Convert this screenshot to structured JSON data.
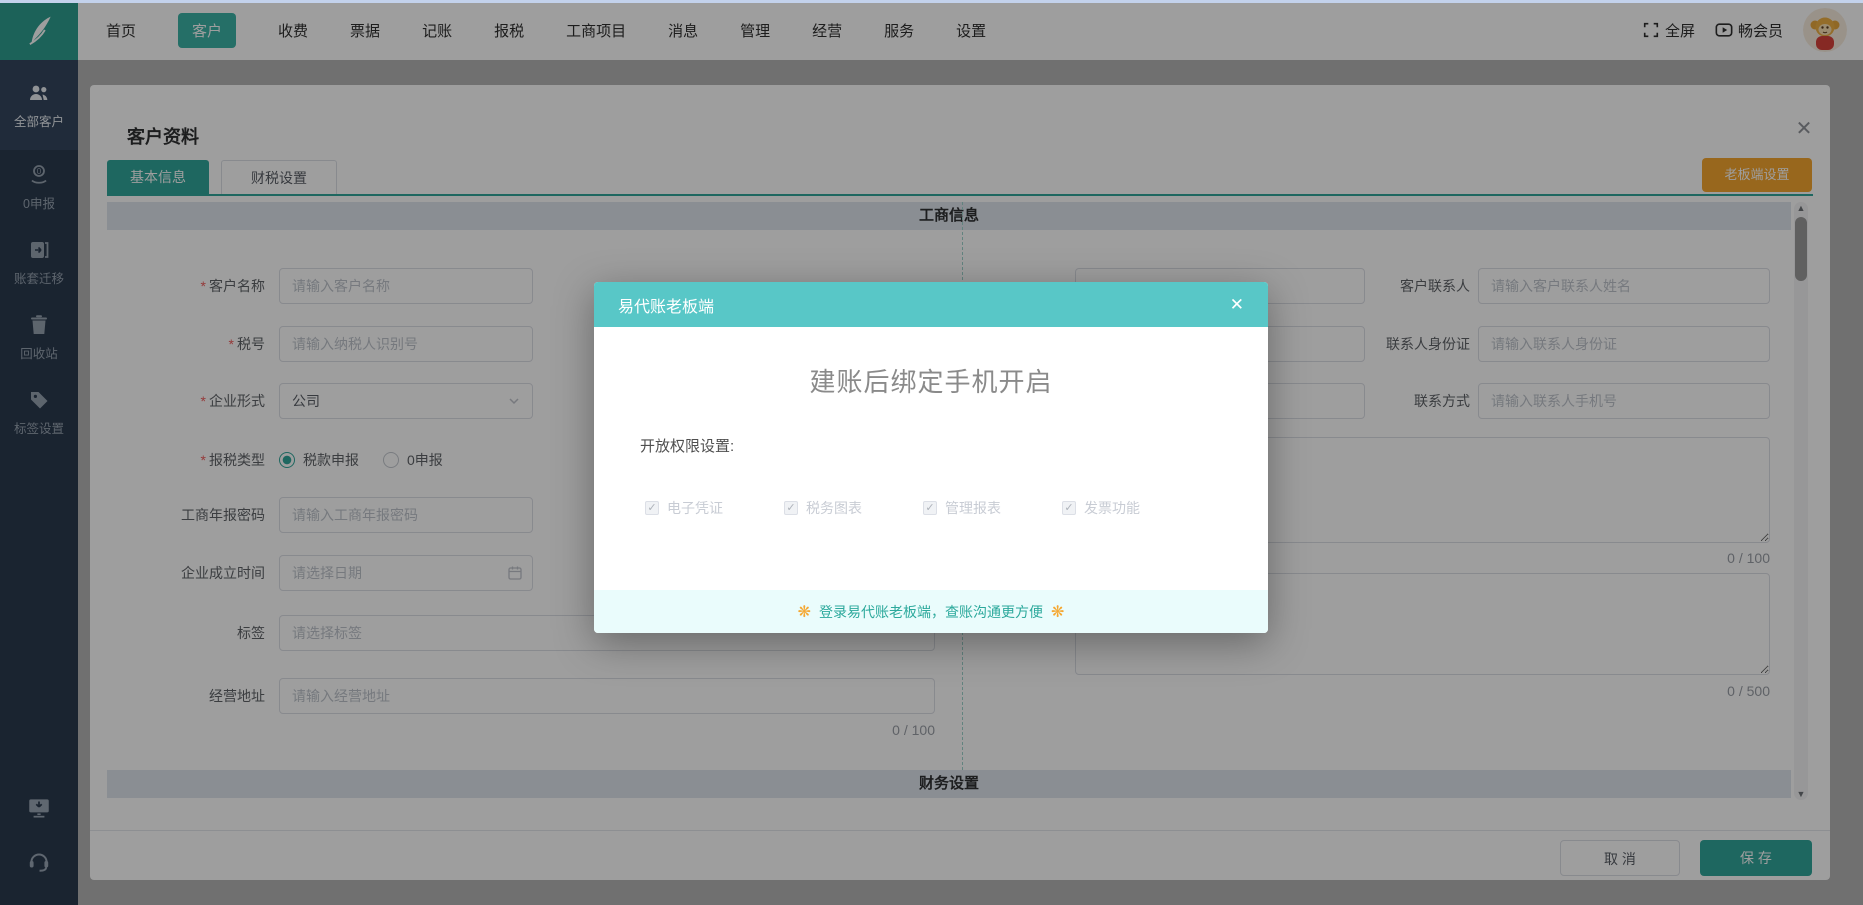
{
  "topnav": {
    "items": [
      "首页",
      "客户",
      "收费",
      "票据",
      "记账",
      "报税",
      "工商项目",
      "消息",
      "管理",
      "经营",
      "服务",
      "设置"
    ],
    "active_item": "客户",
    "fullscreen_label": "全屏",
    "member_label": "畅会员"
  },
  "sidebar": {
    "items": [
      {
        "label": "全部客户",
        "icon": "users-icon",
        "active": true
      },
      {
        "label": "0申报",
        "icon": "zero-declare-icon",
        "active": false
      },
      {
        "label": "账套迁移",
        "icon": "ledger-migrate-icon",
        "active": false
      },
      {
        "label": "回收站",
        "icon": "trash-icon",
        "active": false
      },
      {
        "label": "标签设置",
        "icon": "tag-icon",
        "active": false
      }
    ]
  },
  "dialog": {
    "title": "客户资料",
    "close_label": "✕",
    "tabs": [
      "基本信息",
      "财税设置"
    ],
    "active_tab": "基本信息",
    "boss_settings_button": "老板端设置",
    "section_business": "工商信息",
    "section_finance": "财务设置",
    "cancel_label": "取 消",
    "save_label": "保 存"
  },
  "form": {
    "left": [
      {
        "label": "客户名称",
        "required": true,
        "placeholder": "请输入客户名称"
      },
      {
        "label": "税号",
        "required": true,
        "placeholder": "请输入纳税人识别号"
      },
      {
        "label": "企业形式",
        "required": true,
        "value": "公司"
      },
      {
        "label": "报税类型",
        "required": true,
        "options": [
          "税款申报",
          "0申报"
        ],
        "selected": "税款申报"
      },
      {
        "label": "工商年报密码",
        "required": false,
        "placeholder": "请输入工商年报密码"
      },
      {
        "label": "企业成立时间",
        "required": false,
        "placeholder": "请选择日期"
      },
      {
        "label": "标签",
        "required": false,
        "placeholder": "请选择标签"
      },
      {
        "label": "经营地址",
        "required": false,
        "placeholder": "请输入经营地址",
        "counter": "0 / 100"
      }
    ],
    "right": [
      {
        "label": "客户联系人",
        "placeholder": "请输入客户联系人姓名"
      },
      {
        "label": "联系人身份证",
        "placeholder": "请输入联系人身份证"
      },
      {
        "label": "联系方式",
        "placeholder": "请输入联系人手机号"
      }
    ],
    "textarea1_counter": "0 / 100",
    "textarea2_counter": "0 / 500"
  },
  "modal": {
    "header": "易代账老板端",
    "close_label": "✕",
    "title": "建账后绑定手机开启",
    "permissions_label": "开放权限设置:",
    "permissions": [
      "电子凭证",
      "税务图表",
      "管理报表",
      "发票功能"
    ],
    "check_glyph": "✓",
    "footer_link": "登录易代账老板端，查账沟通更方便",
    "confetti_glyph": "❋"
  },
  "colors": {
    "brand_teal": "#31a79b",
    "modal_teal": "#58c7c7",
    "orange": "#f5a730",
    "sidebar": "#2b3a4e"
  }
}
